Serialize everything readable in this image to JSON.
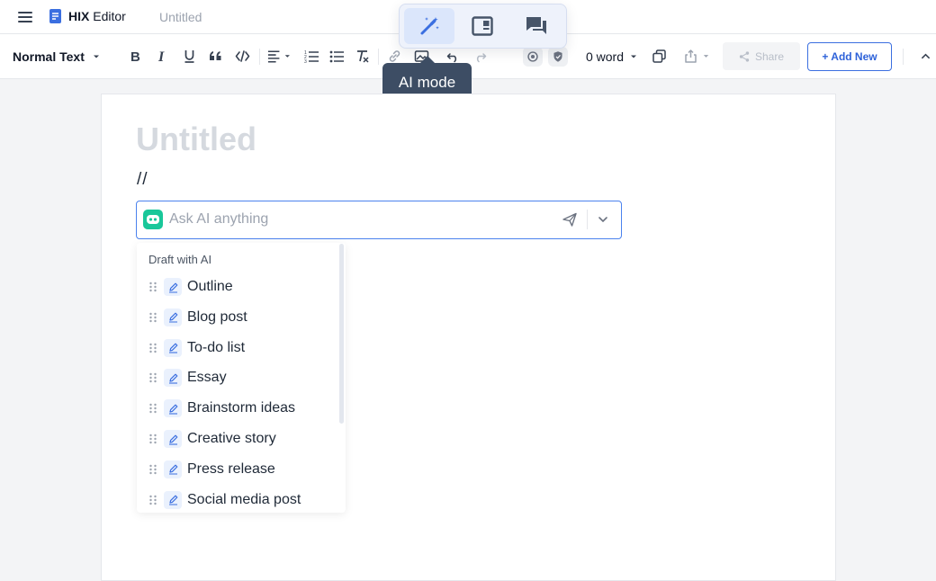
{
  "header": {
    "brand_strong": "HIX",
    "brand_rest": " Editor",
    "doc_name": "Untitled"
  },
  "mode_switch": {
    "active": "ai-mode",
    "tooltip": "AI mode",
    "accent": "#3b6fe0"
  },
  "toolbar": {
    "text_style": "Normal Text",
    "word_count": "0 word",
    "share_label": "Share",
    "add_new_label": "+ Add New"
  },
  "editor": {
    "title_placeholder": "Untitled",
    "typed_text": "//"
  },
  "ask": {
    "placeholder": "Ask AI anything",
    "value": "",
    "bot_color": "#19c79a"
  },
  "dropdown": {
    "header": "Draft with AI",
    "items": [
      {
        "label": "Outline"
      },
      {
        "label": "Blog post"
      },
      {
        "label": "To-do list"
      },
      {
        "label": "Essay"
      },
      {
        "label": "Brainstorm ideas"
      },
      {
        "label": "Creative story"
      },
      {
        "label": "Press release"
      },
      {
        "label": "Social media post"
      }
    ]
  }
}
